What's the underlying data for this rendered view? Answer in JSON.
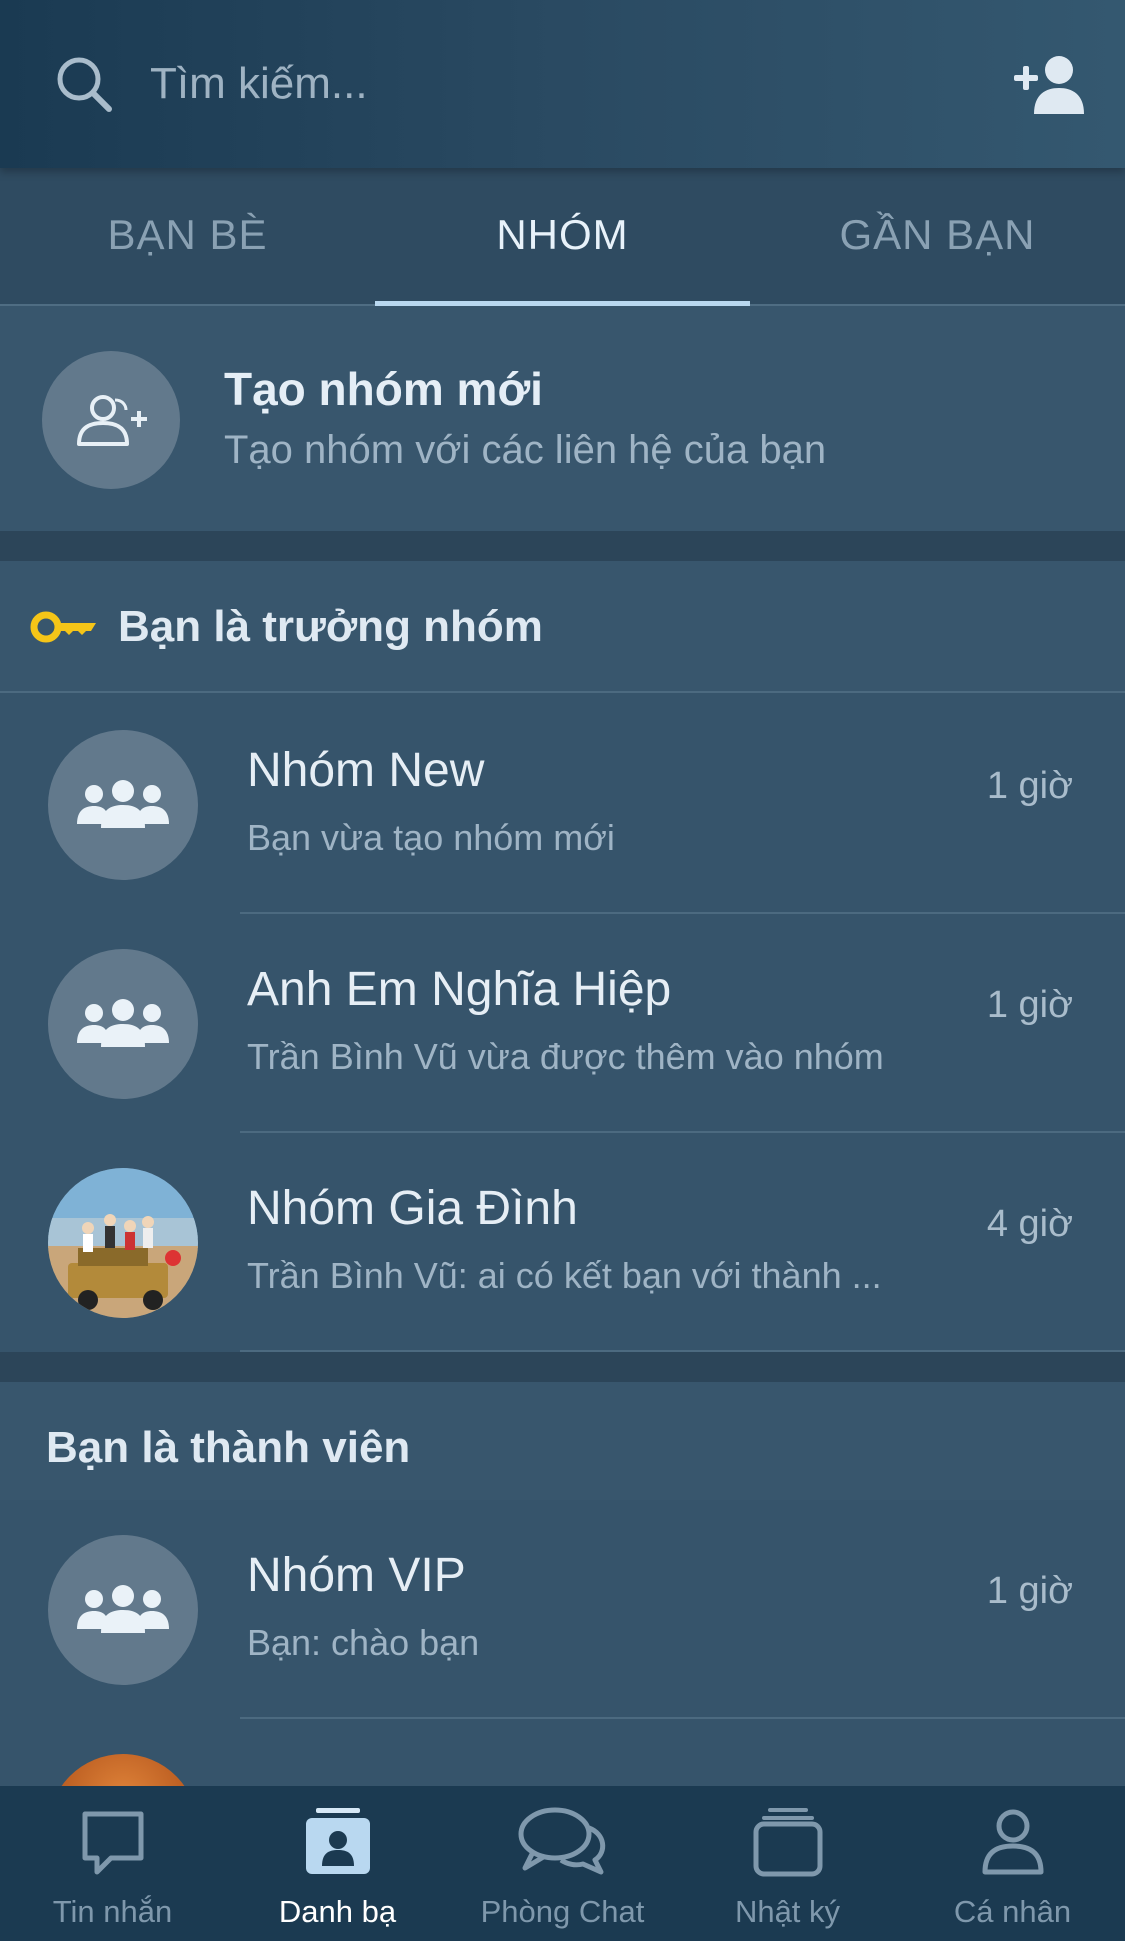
{
  "search": {
    "placeholder": "Tìm kiếm..."
  },
  "tabs": [
    {
      "label": "BẠN BÈ",
      "active": false
    },
    {
      "label": "NHÓM",
      "active": true
    },
    {
      "label": "GẦN BẠN",
      "active": false
    }
  ],
  "create_group": {
    "title": "Tạo nhóm mới",
    "subtitle": "Tạo nhóm với các liên hệ của bạn"
  },
  "sections": [
    {
      "title": "Bạn là trưởng nhóm",
      "icon": "key-icon",
      "groups": [
        {
          "name": "Nhóm New",
          "message": "Bạn vừa tạo nhóm mới",
          "time": "1 giờ",
          "avatar": "group-icon"
        },
        {
          "name": "Anh Em Nghĩa Hiệp",
          "message": "Trần Bình Vũ vừa được thêm vào nhóm",
          "time": "1 giờ",
          "avatar": "group-icon"
        },
        {
          "name": "Nhóm Gia Đình",
          "message": "Trần Bình Vũ: ai có kết bạn với thành ...",
          "time": "4 giờ",
          "avatar": "photo"
        }
      ]
    },
    {
      "title": "Bạn là thành viên",
      "groups": [
        {
          "name": "Nhóm VIP",
          "message": "Bạn: chào bạn",
          "time": "1 giờ",
          "avatar": "group-icon"
        }
      ]
    }
  ],
  "bottom_nav": [
    {
      "label": "Tin nhắn",
      "icon": "message-icon",
      "active": false
    },
    {
      "label": "Danh bạ",
      "icon": "contacts-icon",
      "active": true
    },
    {
      "label": "Phòng Chat",
      "icon": "chat-rooms-icon",
      "active": false
    },
    {
      "label": "Nhật ký",
      "icon": "timeline-icon",
      "active": false
    },
    {
      "label": "Cá nhân",
      "icon": "profile-icon",
      "active": false
    }
  ],
  "colors": {
    "key": "#f5c518",
    "background": "#36546b",
    "nav": "#1b3a51"
  }
}
